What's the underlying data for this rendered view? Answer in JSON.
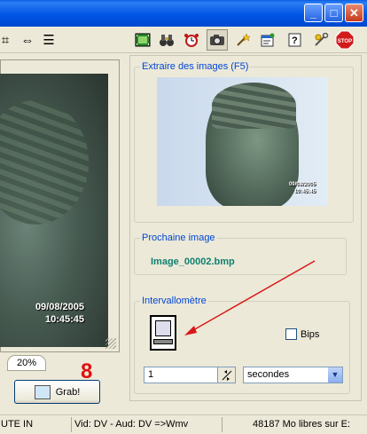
{
  "window": {
    "minimize_label": "_",
    "maximize_label": "□",
    "close_label": "✕"
  },
  "toolbar": {
    "icons": [
      "crop-icon",
      "flip-horizontal-icon",
      "list-icon",
      "filmstrip-icon",
      "binoculars-icon",
      "alarm-clock-icon",
      "camera-icon",
      "magic-wand-icon",
      "properties-icon",
      "help-icon",
      "tools-icon",
      "stop-icon"
    ],
    "stop_label": "STOP"
  },
  "video": {
    "date": "09/08/2005",
    "time": "10:45:45"
  },
  "zoom": {
    "label": "20%"
  },
  "annotation": {
    "number": "8"
  },
  "grab": {
    "label": "Grab!"
  },
  "extract_group": {
    "legend": "Extraire des images (F5)",
    "preview_date": "09/08/2005",
    "preview_time": "10:45:45"
  },
  "next_image_group": {
    "legend": "Prochaine image",
    "filename": "Image_00002.bmp"
  },
  "interval_group": {
    "legend": "Intervallomètre",
    "bips_label": "Bips",
    "bips_checked": false,
    "interval_value": "1",
    "unit_selected": "secondes"
  },
  "statusbar": {
    "left": "UTE IN",
    "format": "Vid: DV  - Aud: DV =>Wmv",
    "free_space": "48187 Mo libres sur E:"
  }
}
